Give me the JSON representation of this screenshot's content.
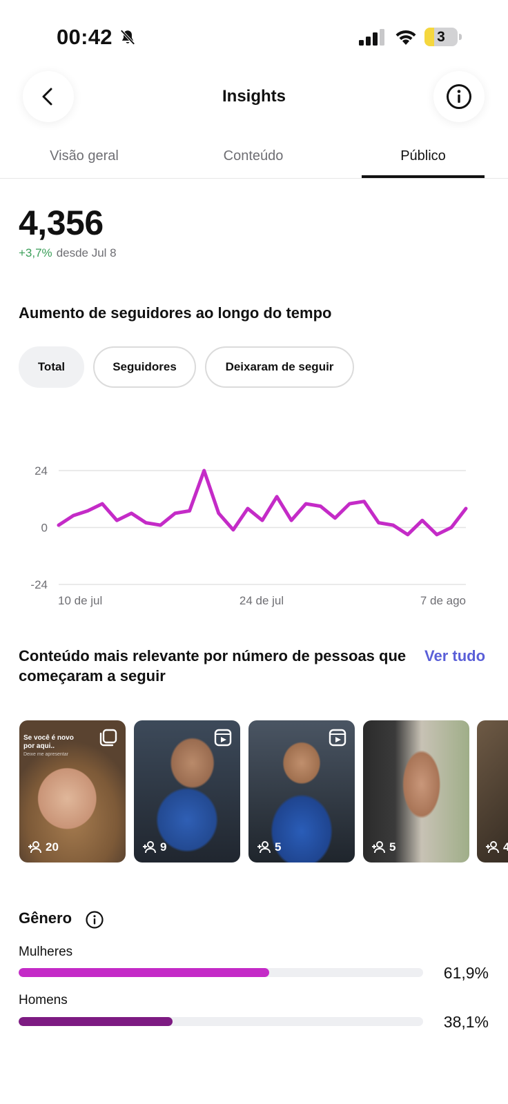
{
  "status_bar": {
    "time": "00:42",
    "battery_level": "3",
    "icons": [
      "bell-slash-icon",
      "signal-icon",
      "wifi-icon",
      "battery-icon"
    ]
  },
  "header": {
    "title": "Insights",
    "back_icon": "chevron-left-icon",
    "info_icon": "info-circle-icon"
  },
  "tabs": [
    {
      "label": "Visão geral",
      "active": false
    },
    {
      "label": "Conteúdo",
      "active": false
    },
    {
      "label": "Público",
      "active": true
    }
  ],
  "followers": {
    "total": "4,356",
    "change": "+3,7%",
    "since": "desde Jul 8"
  },
  "growth_section": {
    "title": "Aumento de seguidores ao longo do tempo",
    "filters": [
      {
        "label": "Total",
        "active": true
      },
      {
        "label": "Seguidores",
        "active": false
      },
      {
        "label": "Deixaram de seguir",
        "active": false
      }
    ]
  },
  "chart_data": {
    "type": "line",
    "x_ticks": [
      "10 de jul",
      "24 de jul",
      "7 de ago"
    ],
    "y_ticks": [
      24,
      0,
      -24
    ],
    "ylim": [
      -24,
      24
    ],
    "grid": true,
    "series": [
      {
        "color": "#c42bc7",
        "values": [
          1,
          5,
          7,
          10,
          3,
          6,
          2,
          1,
          6,
          7,
          24,
          6,
          -1,
          8,
          3,
          13,
          3,
          10,
          9,
          4,
          10,
          11,
          2,
          1,
          -3,
          3,
          -3,
          0,
          8
        ]
      }
    ]
  },
  "content_section": {
    "title": "Conteúdo mais relevante por número de pessoas que começaram a seguir",
    "see_all": "Ver tudo",
    "items": [
      {
        "count": "20",
        "type_icon": "carousel-icon",
        "caption_line1": "Se você é novo",
        "caption_line2": "por aqui..",
        "caption_line3": "Deixe me apresentar"
      },
      {
        "count": "9",
        "type_icon": "reels-icon"
      },
      {
        "count": "5",
        "type_icon": "reels-icon"
      },
      {
        "count": "5",
        "type_icon": "reels-icon"
      },
      {
        "count": "4",
        "type_icon": "reels-icon"
      }
    ]
  },
  "gender": {
    "title": "Gênero",
    "info_icon": "info-circle-icon",
    "rows": [
      {
        "label": "Mulheres",
        "percent_text": "61,9%",
        "value": 61.9,
        "color": "#c42bc7"
      },
      {
        "label": "Homens",
        "percent_text": "38,1%",
        "value": 38.1,
        "color": "#7d1b82"
      }
    ]
  }
}
